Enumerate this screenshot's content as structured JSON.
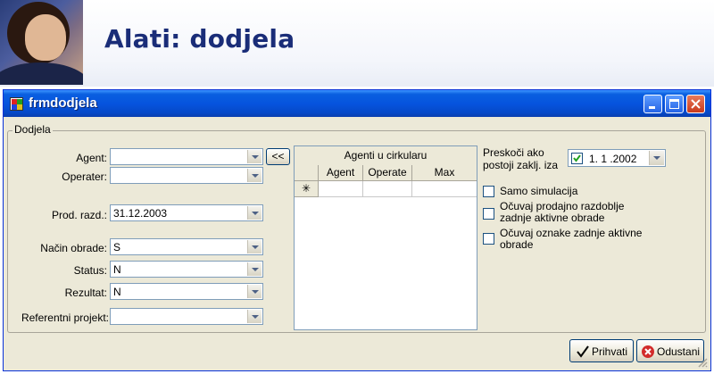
{
  "slide": {
    "title": "Alati: dodjela"
  },
  "window": {
    "title": "frmdodjela"
  },
  "group": {
    "label": "Dodjela"
  },
  "form": {
    "agent_label": "Agent:",
    "agent_value": "",
    "operater_label": "Operater:",
    "operater_value": "",
    "move_button": "<<",
    "prod_razd_label": "Prod. razd.:",
    "prod_razd_value": "31.12.2003",
    "nacin_obrade_label": "Način obrade:",
    "nacin_obrade_value": "S",
    "status_label": "Status:",
    "status_value": "N",
    "rezultat_label": "Rezultat:",
    "rezultat_value": "N",
    "ref_projekt_label": "Referentni projekt:",
    "ref_projekt_value": ""
  },
  "grid": {
    "title": "Agenti u cirkularu",
    "columns": [
      "Agent",
      "Operate",
      "Max"
    ],
    "new_row_marker": "✳"
  },
  "options": {
    "preskoci_label_line1": "Preskoči ako",
    "preskoci_label_line2": "postoji zaklj. iza",
    "preskoci_checked": true,
    "preskoci_date": "1. 1 .2002",
    "samo_simulacija": "Samo simulacija",
    "ocuvaj_razdoblje_line1": "Očuvaj prodajno razdoblje",
    "ocuvaj_razdoblje_line2": "zadnje aktivne obrade",
    "ocuvaj_oznake_line1": "Očuvaj oznake zadnje aktivne",
    "ocuvaj_oznake_line2": "obrade"
  },
  "buttons": {
    "accept": "Prihvati",
    "cancel": "Odustani"
  },
  "colors": {
    "title_blue": "#1a2d78",
    "xp_titlebar": "#0654de",
    "window_bg": "#ece9d8"
  }
}
